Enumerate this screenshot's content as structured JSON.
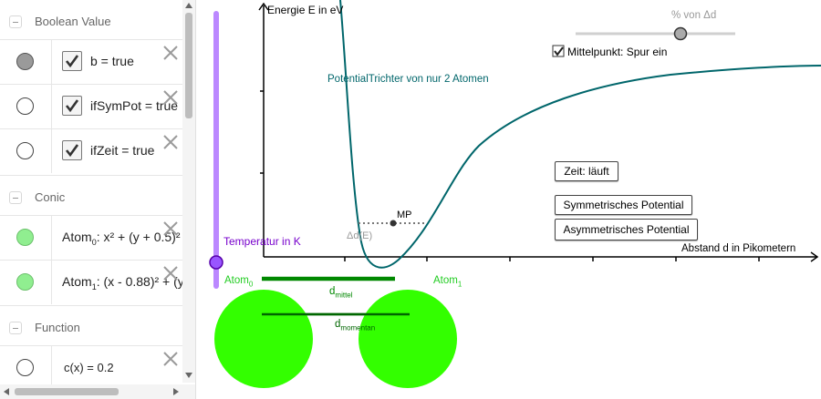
{
  "algebra": {
    "categories": {
      "boolean": "Boolean Value",
      "conic": "Conic",
      "function": "Function"
    },
    "items": [
      {
        "expr": "b = true"
      },
      {
        "expr": "ifSymPot = true"
      },
      {
        "expr": "ifZeit = true"
      },
      {
        "name": "Atom",
        "sub": "0",
        "expr_rest": ": x² + (y + 0.5)²"
      },
      {
        "name": "Atom",
        "sub": "1",
        "expr_rest": ": (x - 0.88)² + (y"
      },
      {
        "expr": "c(x) = 0.2"
      }
    ]
  },
  "graph": {
    "y_axis_label": "Energie E in eV",
    "x_axis_label": "Abstand d in Pikometern",
    "curve_label": "PotentialTrichter von nur 2 Atomen",
    "slider_label": "% von Δd",
    "checkbox_label": "Mittelpunkt: Spur ein",
    "temp_label": "Temperatur in K",
    "mp_label": "MP",
    "delta_label": "Δd(E)",
    "atom0": {
      "name": "Atom",
      "sub": "0"
    },
    "atom1": {
      "name": "Atom",
      "sub": "1"
    },
    "d_mittel": {
      "base": "d",
      "sub": "mittel"
    },
    "d_momentan": {
      "base": "d",
      "sub": "momentan"
    },
    "buttons": {
      "zeit": "Zeit: läuft",
      "sym": "Symmetrisches Potential",
      "asym": "Asymmetrisches Potential"
    },
    "colors": {
      "curve": "#00666b",
      "atom": "#33ff00",
      "label_green": "#22cc22",
      "dark_green": "#008800",
      "temp_slider": "#bb88ff",
      "temp_text": "#7700cc"
    }
  }
}
